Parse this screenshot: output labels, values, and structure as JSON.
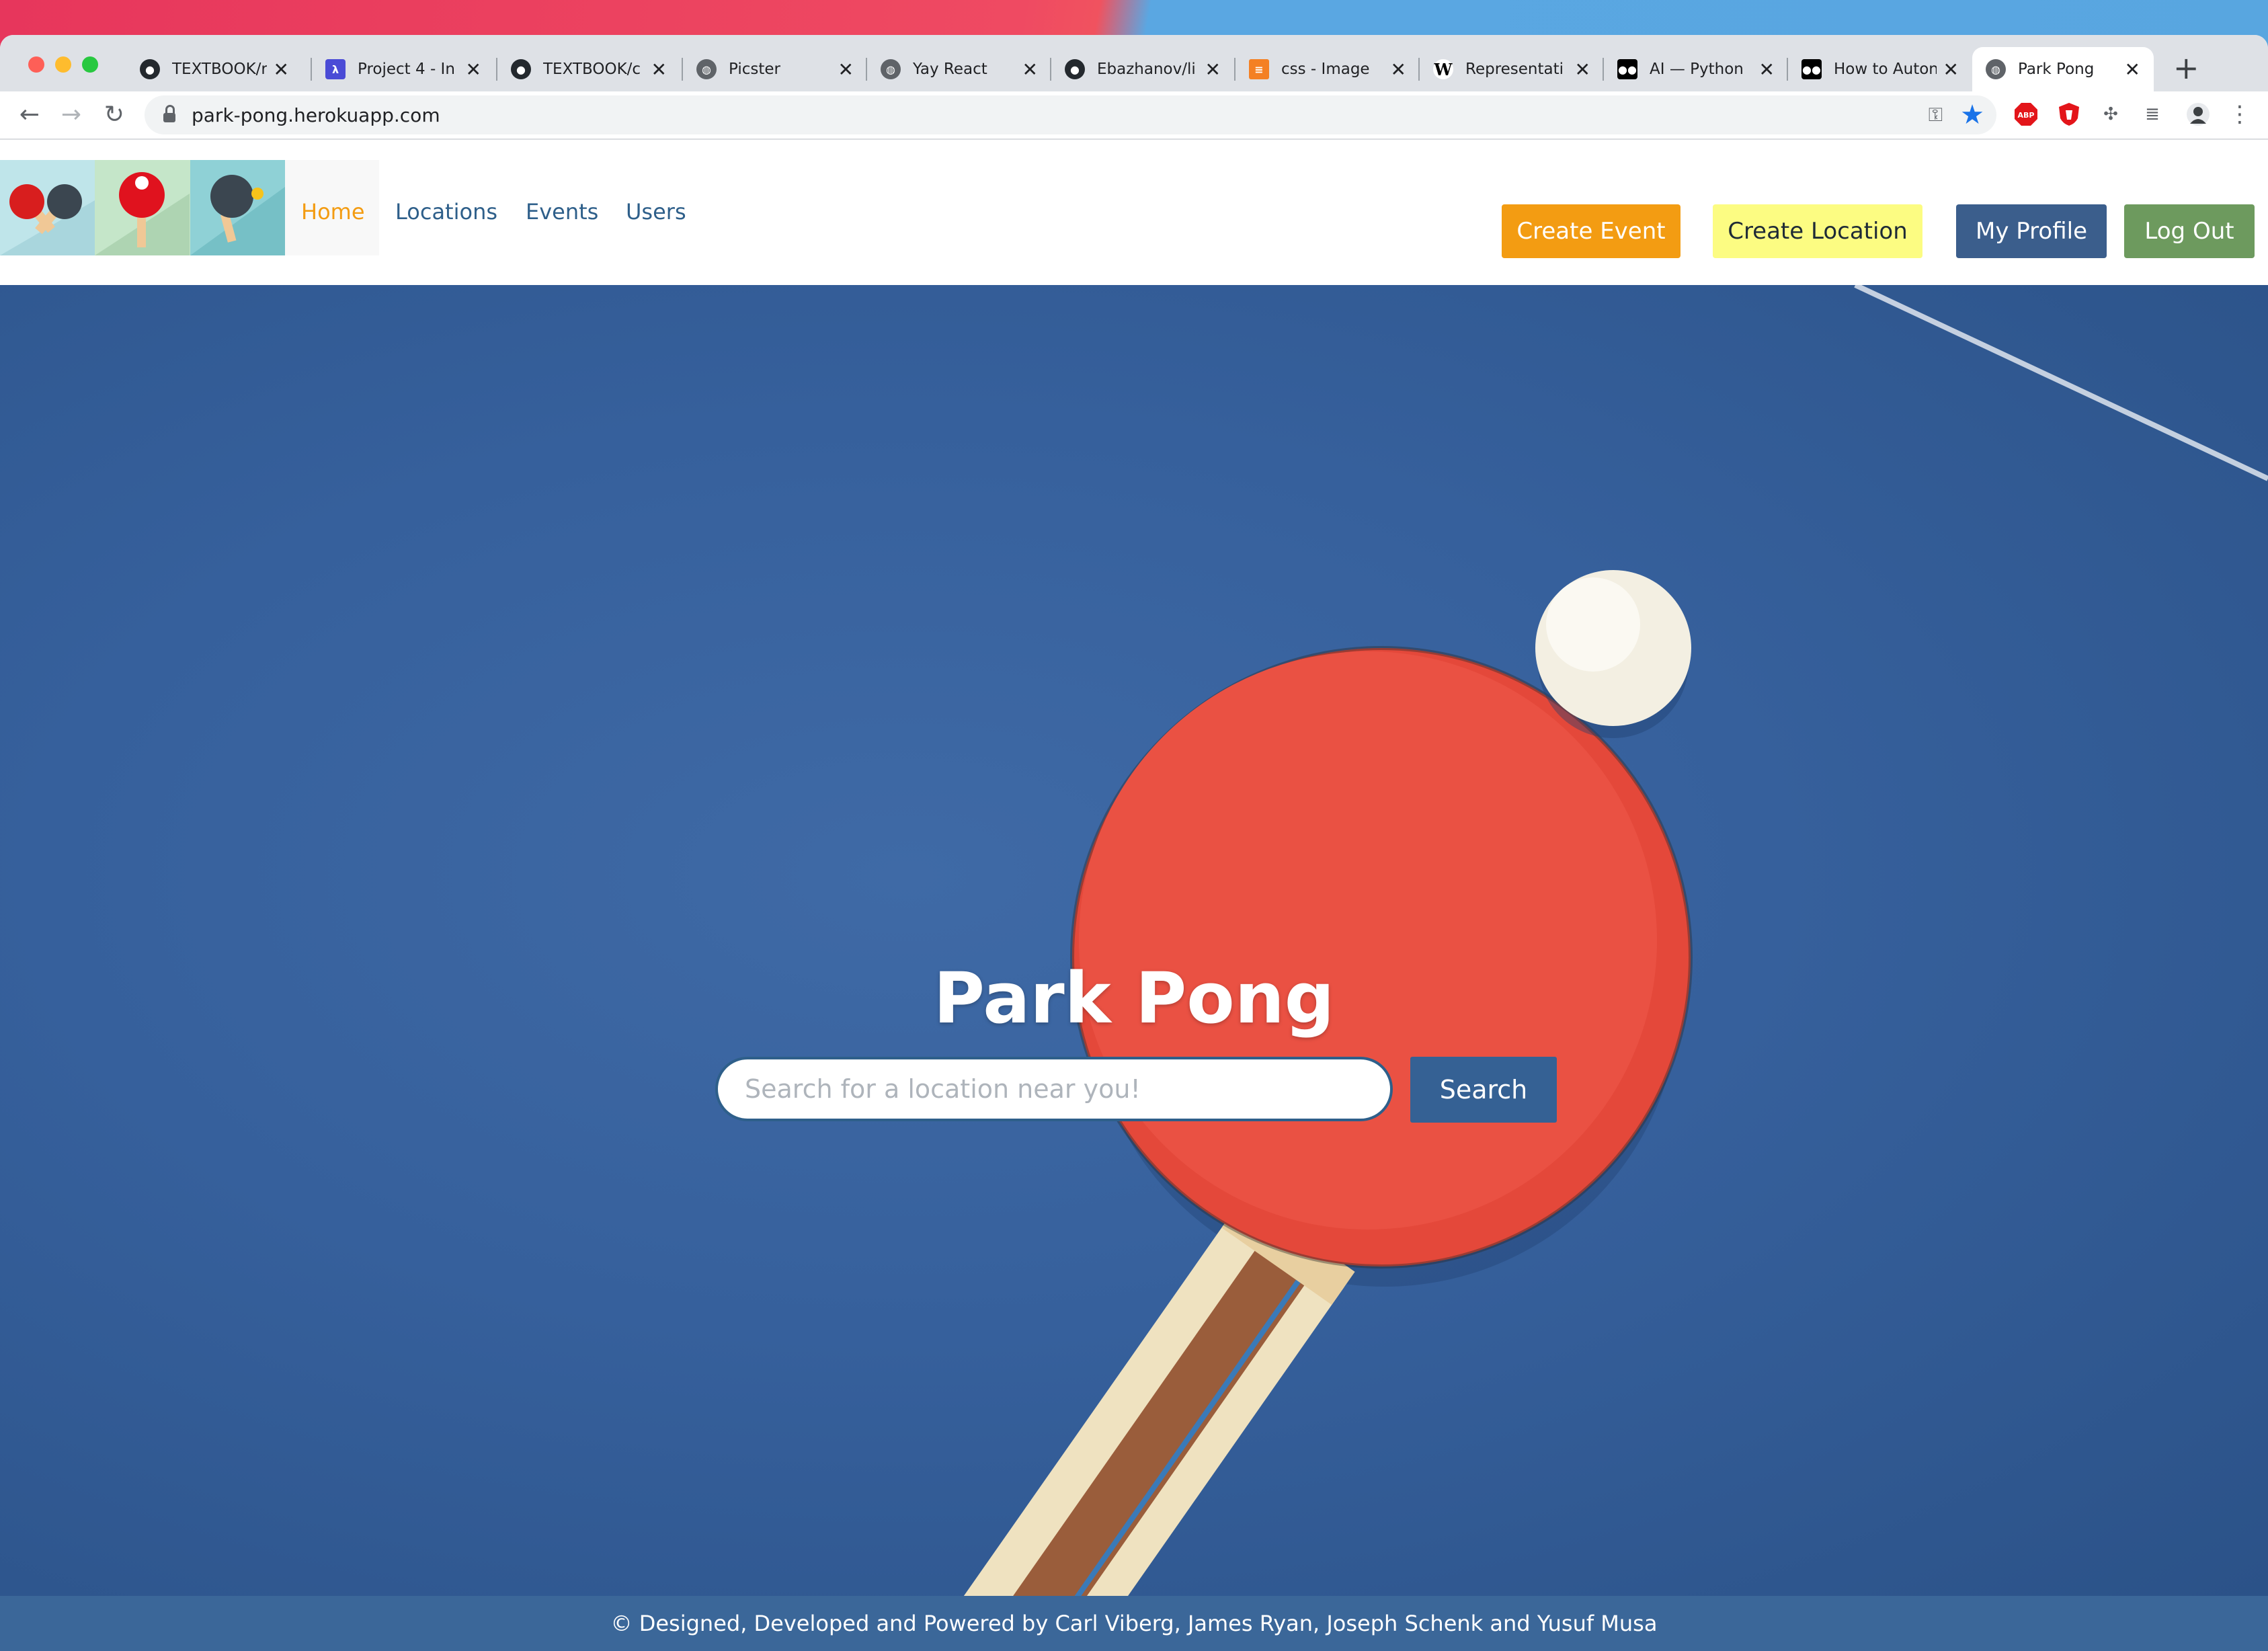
{
  "browser": {
    "tabs": [
      {
        "title": "TEXTBOOK/r",
        "favicon": "github-icon",
        "color": "#24292e"
      },
      {
        "title": "Project 4 - In",
        "favicon": "lambda-icon",
        "color": "#4a4bd6"
      },
      {
        "title": "TEXTBOOK/c",
        "favicon": "github-icon",
        "color": "#24292e"
      },
      {
        "title": "Picster",
        "favicon": "globe-icon",
        "color": "#5f6368"
      },
      {
        "title": "Yay React",
        "favicon": "globe-icon",
        "color": "#5f6368"
      },
      {
        "title": "Ebazhanov/li",
        "favicon": "github-icon",
        "color": "#24292e"
      },
      {
        "title": "css - Image",
        "favicon": "stackoverflow-icon",
        "color": "#f48024"
      },
      {
        "title": "Representati",
        "favicon": "wikipedia-icon",
        "color": "#ffffff"
      },
      {
        "title": "AI — Python",
        "favicon": "medium-icon",
        "color": "#000000"
      },
      {
        "title": "How to Auton",
        "favicon": "medium-icon",
        "color": "#000000"
      },
      {
        "title": "Park Pong",
        "favicon": "globe-icon",
        "color": "#5f6368",
        "active": true
      }
    ],
    "url": "park-pong.herokuapp.com"
  },
  "site": {
    "nav": {
      "home": "Home",
      "locations": "Locations",
      "events": "Events",
      "users": "Users"
    },
    "buttons": {
      "create_event": "Create Event",
      "create_location": "Create Location",
      "my_profile": "My Profile",
      "log_out": "Log Out"
    },
    "hero": {
      "title": "Park Pong",
      "search_placeholder": "Search for a location near you!",
      "search_button": "Search"
    },
    "footer": "© Designed, Developed and Powered by Carl Viberg, James Ryan, Joseph Schenk and Yusuf Musa"
  },
  "colors": {
    "create_event": "#f39c12",
    "create_location": "#fcfc82",
    "my_profile": "#3b5e8c",
    "log_out": "#6d9a5e",
    "active_link": "#f39c12",
    "link": "#2e5f8a",
    "footer": "#3b6799"
  }
}
